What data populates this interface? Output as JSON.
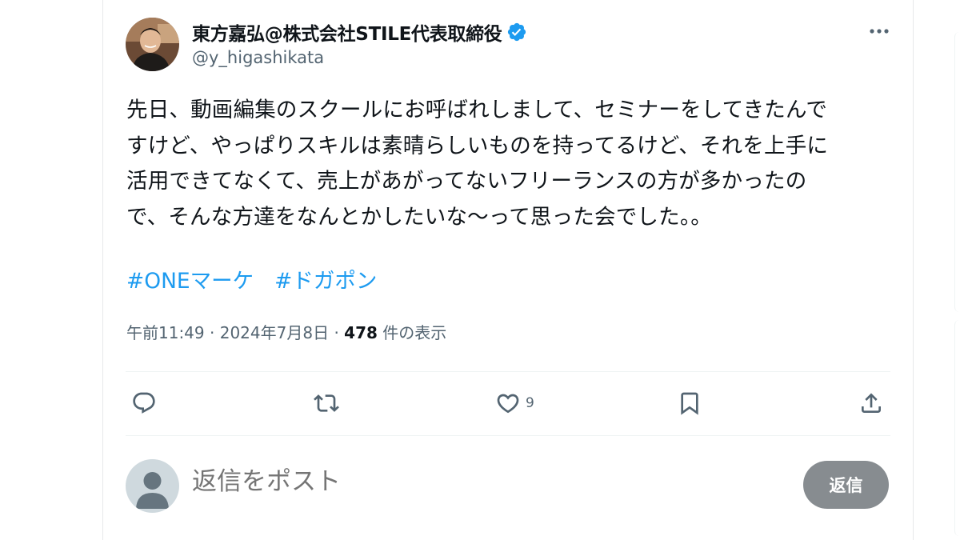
{
  "post": {
    "author_name": "東方嘉弘@株式会社STILE代表取締役",
    "author_handle": "@y_higashikata",
    "verified_icon": "verified-badge-icon",
    "text_lines": [
      "先日、動画編集のスクールにお呼ばれしまして、セミナーをしてきたんで",
      "すけど、やっぱりスキルは素晴らしいものを持ってるけど、それを上手に",
      "活用できてなくて、売上があがってないフリーランスの方が多かったの",
      "で、そんな方達をなんとかしたいな〜って思った会でした。。"
    ],
    "hashtags": [
      "#ONEマーケ",
      "#ドガポン"
    ],
    "time": "午前11:49",
    "separator": "·",
    "date": "2024年7月8日",
    "views_count": "478",
    "views_label": "件の表示"
  },
  "actions": {
    "reply_icon": "reply-icon",
    "repost_icon": "repost-icon",
    "like_icon": "heart-icon",
    "like_count": "9",
    "bookmark_icon": "bookmark-icon",
    "share_icon": "share-icon"
  },
  "composer": {
    "placeholder": "返信をポスト",
    "button_label": "返信"
  },
  "colors": {
    "text": "#0f1419",
    "secondary": "#536471",
    "accent": "#1d9bf0",
    "reply_button": "#878c90",
    "border": "#eff3f4"
  }
}
